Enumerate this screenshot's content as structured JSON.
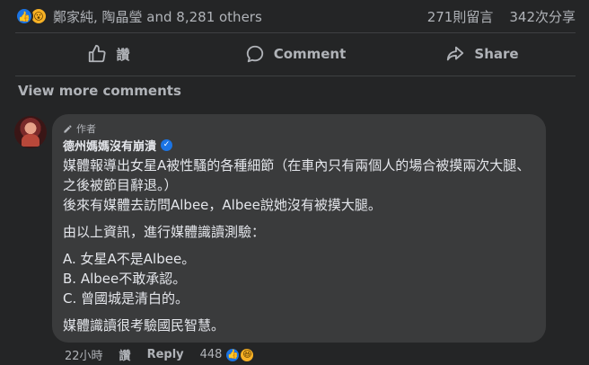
{
  "reactions": {
    "icons": [
      "like-icon",
      "wow-icon"
    ],
    "names": "鄭家純, 陶晶瑩 and 8,281 others",
    "comments": "271則留言",
    "shares": "342次分享"
  },
  "actions": {
    "like_label": "讚",
    "comment_label": "Comment",
    "share_label": "Share"
  },
  "view_more": "View more comments",
  "comment": {
    "author_tag": "作者",
    "author": "德州媽媽沒有崩潰",
    "verified": true,
    "paragraphs": [
      "媒體報導出女星A被性騷的各種細節（在車內只有兩個人的場合被摸兩次大腿、之後被節目辭退。）\n後來有媒體去訪問Albee，Albee說她沒有被摸大腿。",
      "由以上資訊，進行媒體識讀測驗：",
      "A. 女星A不是Albee。\nB. Albee不敢承認。\nC. 曾國城是清白的。",
      "媒體識讀很考驗國民智慧。"
    ],
    "time": "22小時",
    "like_label": "讚",
    "reply_label": "Reply",
    "reaction_count": "448"
  },
  "colors": {
    "background": "#242526",
    "bubble": "#3a3b3c",
    "text": "#e4e6eb",
    "secondary": "#b0b3b8",
    "accent": "#1b74e4"
  }
}
